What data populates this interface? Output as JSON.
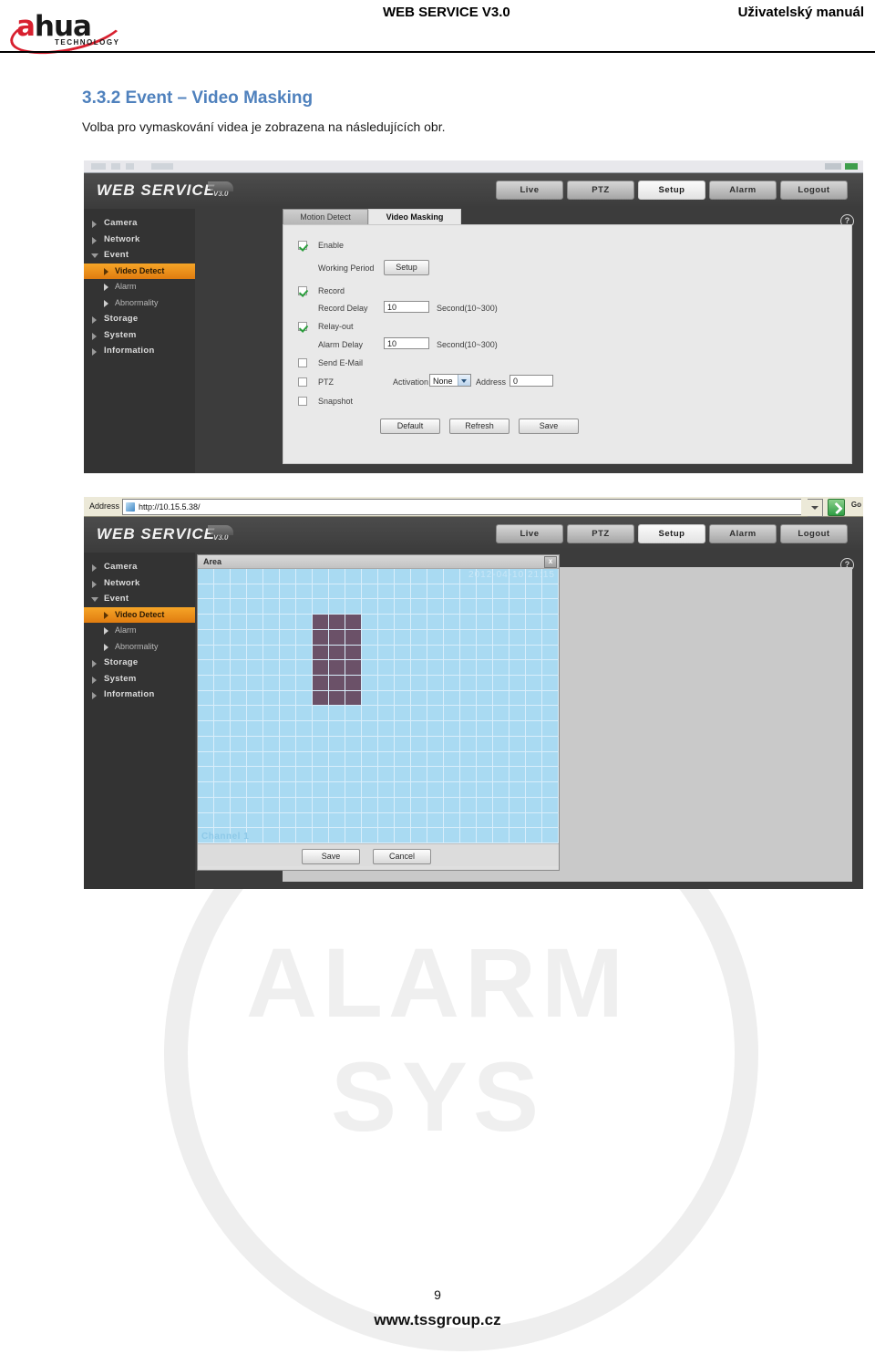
{
  "header": {
    "logo_a": "a",
    "logo_rest": "hua",
    "logo_sub": "TECHNOLOGY",
    "center_title": "WEB SERVICE V3.0",
    "right_title": "Uživatelský manuál"
  },
  "section": {
    "heading": "3.3.2 Event – Video Masking",
    "paragraph": "Volba pro vymaskování videa je zobrazena na následujících obr."
  },
  "watermark": {
    "text": "ALARM SYS"
  },
  "screenshot_top": {
    "brand": "WEB  SERVICE",
    "version": "V3.0",
    "nav": [
      {
        "label": "Live",
        "active": false
      },
      {
        "label": "PTZ",
        "active": false
      },
      {
        "label": "Setup",
        "active": true
      },
      {
        "label": "Alarm",
        "active": false
      },
      {
        "label": "Logout",
        "active": false
      }
    ],
    "help_glyph": "?",
    "sidebar": [
      {
        "label": "Camera",
        "type": "group",
        "open": false
      },
      {
        "label": "Network",
        "type": "group",
        "open": false
      },
      {
        "label": "Event",
        "type": "group",
        "open": true
      },
      {
        "label": "Video Detect",
        "type": "sub",
        "selected": true
      },
      {
        "label": "Alarm",
        "type": "sub",
        "selected": false
      },
      {
        "label": "Abnormality",
        "type": "sub",
        "selected": false
      },
      {
        "label": "Storage",
        "type": "group",
        "open": false
      },
      {
        "label": "System",
        "type": "group",
        "open": false
      },
      {
        "label": "Information",
        "type": "group",
        "open": false
      }
    ],
    "tabs": [
      {
        "label": "Motion Detect",
        "active": false
      },
      {
        "label": "Video Masking",
        "active": true
      }
    ],
    "form": {
      "enable_label": "Enable",
      "enable_checked": true,
      "working_period_label": "Working Period",
      "working_period_button": "Setup",
      "record_label": "Record",
      "record_checked": true,
      "record_delay_label": "Record Delay",
      "record_delay_value": "10",
      "record_delay_unit": "Second(10~300)",
      "relay_out_label": "Relay-out",
      "relay_out_checked": true,
      "alarm_delay_label": "Alarm Delay",
      "alarm_delay_value": "10",
      "alarm_delay_unit": "Second(10~300)",
      "send_email_label": "Send E-Mail",
      "send_email_checked": false,
      "ptz_label": "PTZ",
      "ptz_checked": false,
      "activation_label": "Activation",
      "activation_value": "None",
      "activation_options": [
        "None"
      ],
      "address_label": "Address",
      "address_value": "0",
      "snapshot_label": "Snapshot",
      "snapshot_checked": false,
      "default_button": "Default",
      "refresh_button": "Refresh",
      "save_button": "Save"
    }
  },
  "screenshot_bottom": {
    "address_label": "Address",
    "address_url": "http://10.15.5.38/",
    "go_label": "Go",
    "brand": "WEB  SERVICE",
    "version": "V3.0",
    "nav": [
      {
        "label": "Live",
        "active": false
      },
      {
        "label": "PTZ",
        "active": false
      },
      {
        "label": "Setup",
        "active": true
      },
      {
        "label": "Alarm",
        "active": false
      },
      {
        "label": "Logout",
        "active": false
      }
    ],
    "help_glyph": "?",
    "sidebar": [
      {
        "label": "Camera",
        "type": "group",
        "open": false
      },
      {
        "label": "Network",
        "type": "group",
        "open": false
      },
      {
        "label": "Event",
        "type": "group",
        "open": true
      },
      {
        "label": "Video Detect",
        "type": "sub",
        "selected": true
      },
      {
        "label": "Alarm",
        "type": "sub",
        "selected": false
      },
      {
        "label": "Abnormality",
        "type": "sub",
        "selected": false
      },
      {
        "label": "Storage",
        "type": "group",
        "open": false
      },
      {
        "label": "System",
        "type": "group",
        "open": false
      },
      {
        "label": "Information",
        "type": "group",
        "open": false
      }
    ],
    "dialog": {
      "title": "Area",
      "close_glyph": "x",
      "osd_timestamp": "2012-04-10 21:15",
      "osd_channel": "Channel 1",
      "save_button": "Save",
      "cancel_button": "Cancel",
      "grid": {
        "columns": 22,
        "rows": 18,
        "cell_color": "#a9daf2",
        "line_color": "#d9eefb",
        "masked_color": "#6b5168",
        "masked_col_start": 8,
        "masked_col_end": 10,
        "masked_row_start": 4,
        "masked_row_end": 9
      }
    }
  },
  "footer": {
    "page_number": "9",
    "site": "www.tssgroup.cz"
  }
}
